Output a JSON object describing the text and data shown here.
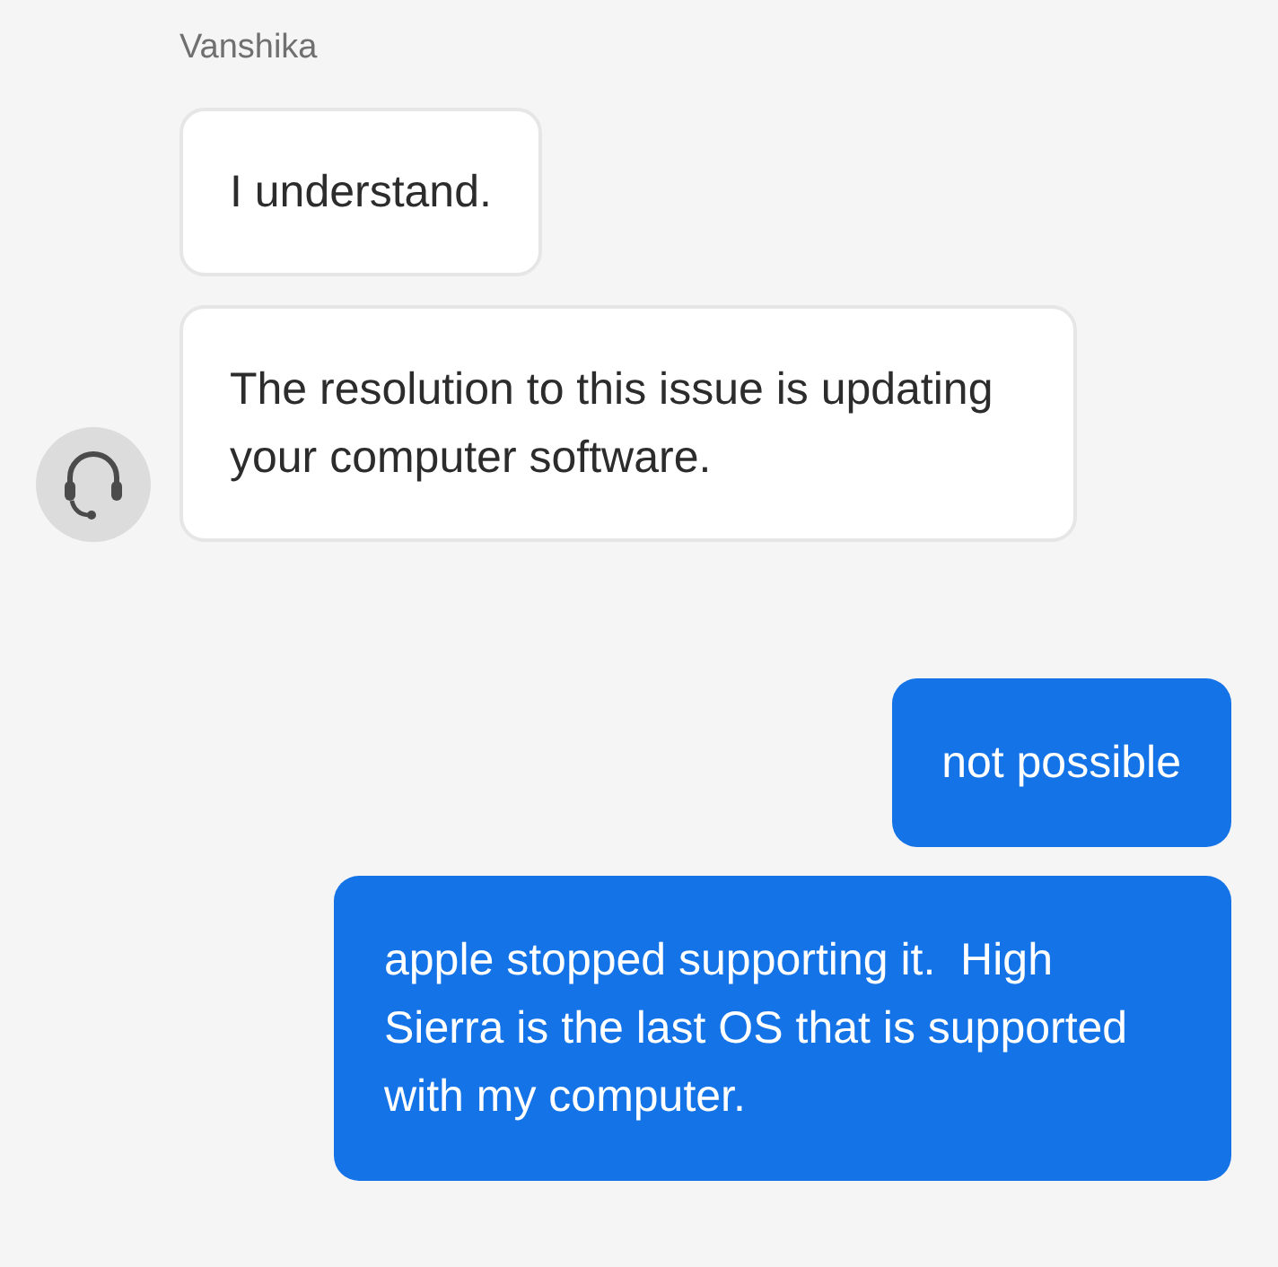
{
  "agent_name": "Vanshika",
  "messages": [
    {
      "kind": "agent",
      "text": "I understand.",
      "avatar": false
    },
    {
      "kind": "agent",
      "text": "The resolution to this issue is updating your computer software.",
      "avatar": true
    },
    {
      "kind": "user",
      "text": "not possible"
    },
    {
      "kind": "user",
      "text": "apple stopped supporting it.  High Sierra is the last OS that is supported with my computer."
    }
  ]
}
